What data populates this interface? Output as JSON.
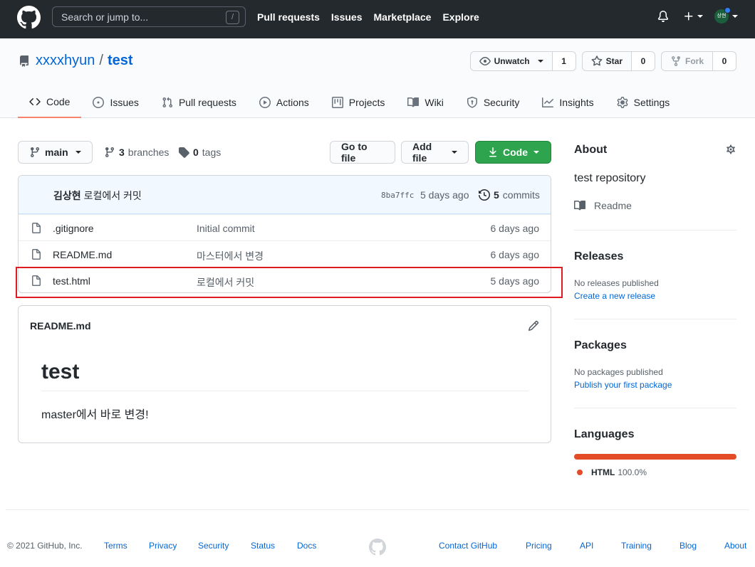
{
  "header": {
    "search_placeholder": "Search or jump to...",
    "search_shortcut": "/",
    "nav": [
      "Pull requests",
      "Issues",
      "Marketplace",
      "Explore"
    ],
    "avatar_text": "상현"
  },
  "repo": {
    "owner": "xxxxhyun",
    "separator": "/",
    "name": "test",
    "watch": {
      "label": "Unwatch",
      "count": "1"
    },
    "star": {
      "label": "Star",
      "count": "0"
    },
    "fork": {
      "label": "Fork",
      "count": "0"
    }
  },
  "tabs": [
    {
      "label": "Code",
      "icon": "code-icon",
      "selected": true
    },
    {
      "label": "Issues",
      "icon": "issue-icon"
    },
    {
      "label": "Pull requests",
      "icon": "pull-request-icon"
    },
    {
      "label": "Actions",
      "icon": "play-icon"
    },
    {
      "label": "Projects",
      "icon": "project-icon"
    },
    {
      "label": "Wiki",
      "icon": "book-icon"
    },
    {
      "label": "Security",
      "icon": "shield-icon"
    },
    {
      "label": "Insights",
      "icon": "graph-icon"
    },
    {
      "label": "Settings",
      "icon": "gear-icon"
    }
  ],
  "toolbar": {
    "branch": "main",
    "branches_count": "3",
    "branches_label": "branches",
    "tags_count": "0",
    "tags_label": "tags",
    "go_to_file": "Go to file",
    "add_file": "Add file",
    "code": "Code"
  },
  "latest_commit": {
    "author": "김상현",
    "message": "로컬에서 커밋",
    "sha": "8ba7ffc",
    "ago": "5 days ago",
    "commits_count": "5",
    "commits_label": "commits"
  },
  "files": [
    {
      "name": ".gitignore",
      "message": "Initial commit",
      "ago": "6 days ago"
    },
    {
      "name": "README.md",
      "message": "마스터에서 변경",
      "ago": "6 days ago"
    },
    {
      "name": "test.html",
      "message": "로컬에서 커밋",
      "ago": "5 days ago"
    }
  ],
  "readme": {
    "filename": "README.md",
    "heading": "test",
    "body": "master에서 바로 변경!"
  },
  "sidebar": {
    "about_title": "About",
    "description": "test repository",
    "readme_link": "Readme",
    "releases_title": "Releases",
    "releases_none": "No releases published",
    "releases_link": "Create a new release",
    "packages_title": "Packages",
    "packages_none": "No packages published",
    "packages_link": "Publish your first package",
    "languages_title": "Languages",
    "language": {
      "name": "HTML",
      "percent": "100.0%",
      "color": "#e34c26"
    }
  },
  "footer": {
    "copyright": "© 2021 GitHub, Inc.",
    "left_links": [
      "Terms",
      "Privacy",
      "Security",
      "Status",
      "Docs"
    ],
    "right_links": [
      "Contact GitHub",
      "Pricing",
      "API",
      "Training",
      "Blog",
      "About"
    ]
  },
  "colors": {
    "header_bg": "#24292e",
    "link": "#0366d6",
    "primary_button": "#2ea44f",
    "tab_underline": "#f9826c",
    "highlight_box": "#e11b22"
  }
}
